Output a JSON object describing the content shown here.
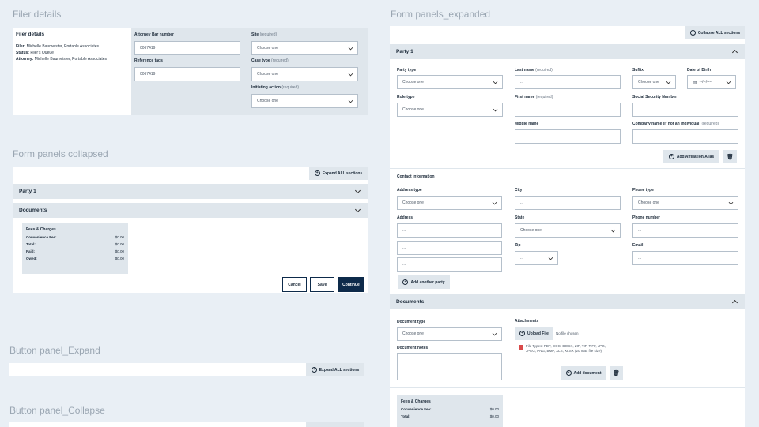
{
  "sections": {
    "filer_details": "Filer details",
    "form_panels_collapsed": "Form panels collapsed",
    "button_panel_expand": "Button panel_Expand",
    "button_panel_collapse": "Button panel_Collapse",
    "form_panels_expanded": "Form panels_expanded"
  },
  "filer": {
    "heading": "Filer details",
    "filer_label": "Filer:",
    "filer_value": "Michelle Baumeister, Portable Associates",
    "status_label": "Status:",
    "status_value": "Filer's Queue",
    "attorney_label": "Attorney:",
    "attorney_value": "Michelle Baumeister, Portable Associates",
    "bar_label": "Attorney Bar number",
    "bar_value": "0067419",
    "ref_label": "Reference tags",
    "ref_value": "0067419",
    "site_label": "Site",
    "site_value": "Choose one",
    "case_label": "Case type",
    "case_value": "Choose one",
    "action_label": "Initiating action",
    "action_value": "Choose one",
    "required": "(required)"
  },
  "collapsed": {
    "expand_all": "Expand ALL sections",
    "party1": "Party 1",
    "documents": "Documents",
    "fees_title": "Fees & Charges",
    "fees": [
      {
        "label": "Convenience Fee:",
        "value": "$0.00"
      },
      {
        "label": "Total:",
        "value": "$0.00"
      },
      {
        "label": "Paid:",
        "value": "$0.00"
      },
      {
        "label": "Owed:",
        "value": "$0.00"
      }
    ],
    "cancel": "Cancel",
    "save": "Save",
    "continue": "Continue"
  },
  "expand_panel": {
    "label": "Expand ALL sections"
  },
  "expanded": {
    "collapse_all": "Collapse ALL sections",
    "party1": "Party 1",
    "party_type": "Party type",
    "party_type_value": "Choose one",
    "role_type": "Role type",
    "role_type_value": "Choose one",
    "last_name": "Last name",
    "first_name": "First name",
    "middle_name": "Middle name",
    "suffix": "Suffix",
    "suffix_value": "Choose one",
    "dob": "Date of Birth",
    "dob_value": "--/--/----",
    "ssn": "Social Security Number",
    "company": "Company name (if not an individual)",
    "required": "(required)",
    "placeholder": "...",
    "add_affiliation": "Add Affiliation/Alias",
    "contact_info": "Contact information",
    "address_type": "Address type",
    "address_type_value": "Choose one",
    "address": "Address",
    "city": "City",
    "state": "State",
    "state_value": "Choose one",
    "zip": "Zip",
    "phone_type": "Phone type",
    "phone_type_value": "Choose one",
    "phone_number": "Phone number",
    "email": "Email",
    "add_party": "Add another party",
    "documents": "Documents",
    "doc_type": "Document type",
    "doc_type_value": "Choose one",
    "doc_notes": "Document notes",
    "attachments": "Attachments",
    "upload": "Upload File",
    "no_file": "No file chosen",
    "file_types": "File Types: PDF, DOC, DOCX, ZIP, TIF, TIFF, JPG, JPEG, PNG, BMP, XLS, XLSX (20 max file size)",
    "add_document": "Add document",
    "fees_title": "Fees & Charges",
    "fees": [
      {
        "label": "Convenience Fee:",
        "value": "$0.00"
      },
      {
        "label": "Total:",
        "value": "$0.00"
      }
    ]
  }
}
